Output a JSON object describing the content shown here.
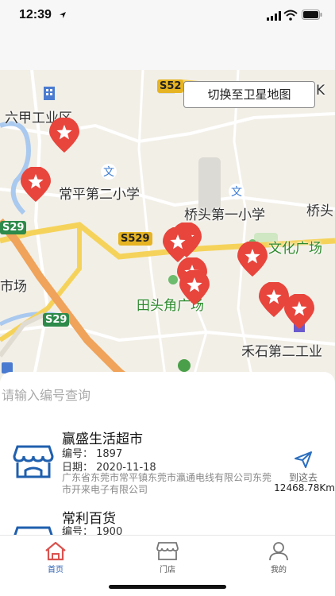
{
  "status_bar": {
    "time": "12:39"
  },
  "map": {
    "satellite_button": "切换至卫星地图",
    "labels": [
      {
        "text": "六甲工业区",
        "cls": ""
      },
      {
        "text": "常平第二小学",
        "cls": ""
      },
      {
        "text": "桥头第一小学",
        "cls": ""
      },
      {
        "text": "桥头",
        "cls": ""
      },
      {
        "text": "文化广场",
        "cls": "green"
      },
      {
        "text": "市场",
        "cls": ""
      },
      {
        "text": "田头角广场",
        "cls": "green"
      },
      {
        "text": "禾石第二工业",
        "cls": ""
      }
    ],
    "road_badges": {
      "s52": "S52",
      "s529": "S529",
      "s29_a": "S29",
      "s29_b": "S29",
      "k": "K"
    },
    "marker_color": "#e8453c",
    "marker_count": 9
  },
  "search": {
    "placeholder": "请输入编号查询"
  },
  "stores": [
    {
      "name": "赢盛生活超市",
      "number": "编号： 1897",
      "date": "日期： 2020-11-18",
      "address": "广东省东莞市常平镇东莞市瀛通电线有限公司东莞市开来电子有限公司",
      "nav_label": "到这去",
      "distance": "12468.78Km"
    },
    {
      "name": "常利百货",
      "number": "编号： 1900"
    }
  ],
  "tabs": [
    {
      "label": "首页",
      "icon": "home-icon",
      "active": true
    },
    {
      "label": "门店",
      "icon": "store-icon",
      "active": false
    },
    {
      "label": "我的",
      "icon": "profile-icon",
      "active": false
    }
  ],
  "colors": {
    "accent": "#2c5fb0",
    "marker": "#e8453c"
  }
}
